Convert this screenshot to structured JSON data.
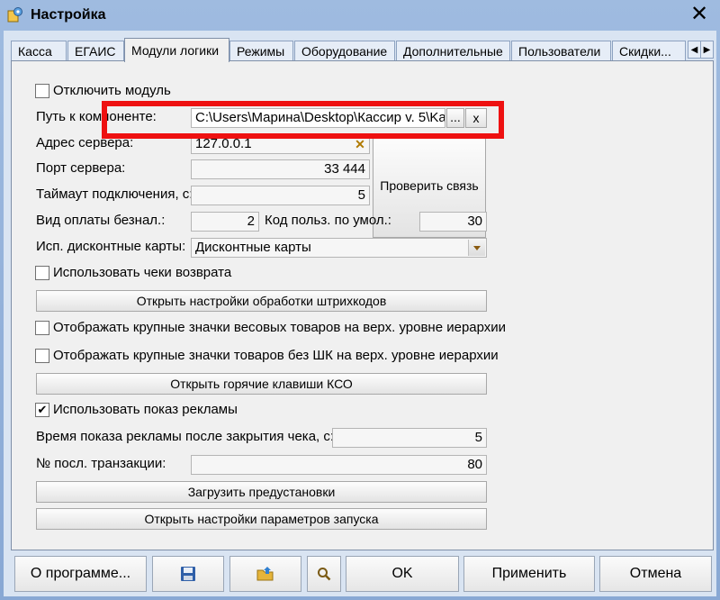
{
  "window": {
    "title": "Настройка",
    "close_glyph": "✕"
  },
  "tabs": [
    "Касса",
    "ЕГАИС",
    "Модули логики",
    "Режимы",
    "Оборудование",
    "Дополнительные",
    "Пользователи",
    "Скидки..."
  ],
  "tab_nav": {
    "left": "◀",
    "right": "▶"
  },
  "form": {
    "disable_module": {
      "label": "Отключить модуль",
      "checked": false
    },
    "component_path": {
      "label": "Путь к компоненте:",
      "value": "C:\\Users\\Марина\\Desktop\\Кассир v. 5\\Ka",
      "browse_label": "...",
      "clear_label": "x"
    },
    "server_address": {
      "label": "Адрес сервера:",
      "value": "127.0.0.1",
      "clear_glyph": "✕"
    },
    "server_port": {
      "label": "Порт сервера:",
      "value": "33 444"
    },
    "check_connection_label": "Проверить связь",
    "connect_timeout": {
      "label": "Таймаут подключения, с:",
      "value": "5"
    },
    "noncash_payment": {
      "label": "Вид оплаты безнал.:",
      "value": "2"
    },
    "default_user_code": {
      "label": "Код польз. по умол.:",
      "value": "30"
    },
    "discount_cards": {
      "label": "Исп. дисконтные карты:",
      "value": "Дисконтные карты"
    },
    "use_return_receipts": {
      "label": "Использовать чеки возврата",
      "checked": false
    },
    "barcode_settings_label": "Открыть настройки обработки штрихкодов",
    "large_icons_weight": {
      "label": "Отображать крупные значки весовых товаров на верх. уровне иерархии",
      "checked": false
    },
    "large_icons_no_barcode": {
      "label": "Отображать крупные значки товаров без ШК на верх. уровне иерархии",
      "checked": false
    },
    "hotkeys_label": "Открыть горячие клавиши КСО",
    "use_ads": {
      "label": "Использовать показ рекламы",
      "checked": true
    },
    "ads_time": {
      "label": "Время показа рекламы после закрытия чека, с:",
      "value": "5"
    },
    "last_transaction": {
      "label": "№ посл. транзакции:",
      "value": "80"
    },
    "load_presets_label": "Загрузить предустановки",
    "launch_params_label": "Открыть настройки параметров запуска"
  },
  "footer": {
    "about": "О программе...",
    "save_icon": "floppy-disk-icon",
    "open_icon": "folder-upload-icon",
    "search_icon": "magnifier-icon",
    "ok": "OK",
    "apply": "Применить",
    "cancel": "Отмена"
  },
  "colors": {
    "highlight": "#ee1111",
    "check_mark": "✔"
  }
}
